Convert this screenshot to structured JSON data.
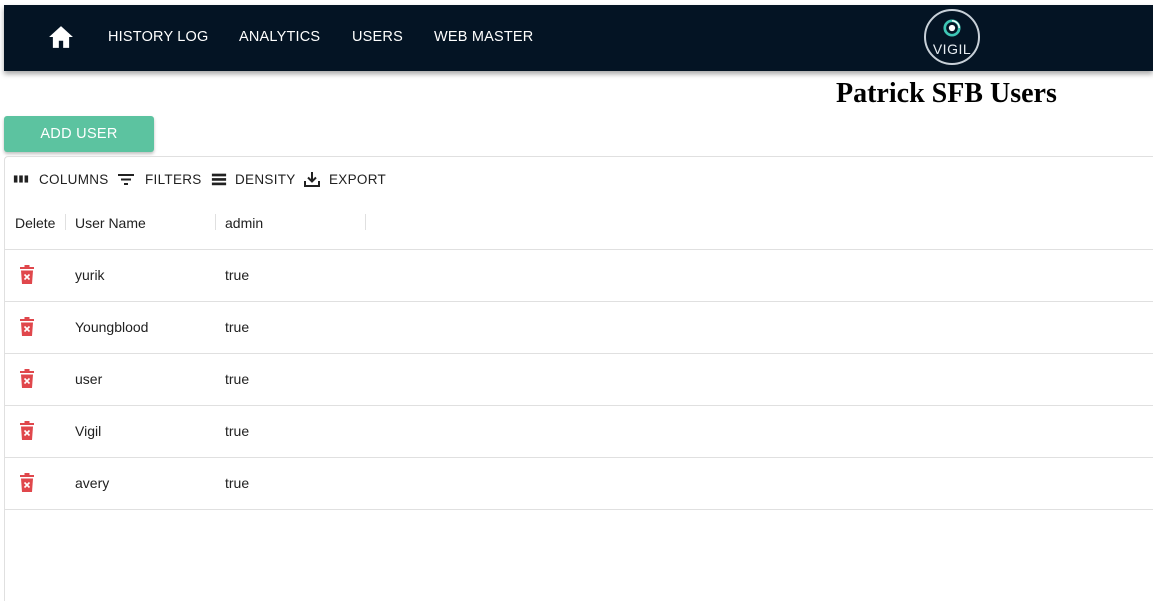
{
  "nav": {
    "home_icon": "home-icon",
    "links": [
      "HISTORY LOG",
      "ANALYTICS",
      "USERS",
      "WEB MASTER"
    ],
    "logo_text": "VIGIL",
    "background": "#041424"
  },
  "page_title": "Patrick SFB Users",
  "add_user_label": "ADD USER",
  "add_user_color": "#5cc3a0",
  "toolbar": {
    "columns": "COLUMNS",
    "filters": "FILTERS",
    "density": "DENSITY",
    "export": "EXPORT"
  },
  "table": {
    "headers": [
      "Delete",
      "User Name",
      "admin"
    ],
    "rows": [
      {
        "username": "yurik",
        "admin": "true"
      },
      {
        "username": "Youngblood",
        "admin": "true"
      },
      {
        "username": "user",
        "admin": "true"
      },
      {
        "username": "Vigil",
        "admin": "true"
      },
      {
        "username": "avery",
        "admin": "true"
      }
    ],
    "delete_icon": "trash-icon",
    "delete_color": "#e0474c"
  }
}
